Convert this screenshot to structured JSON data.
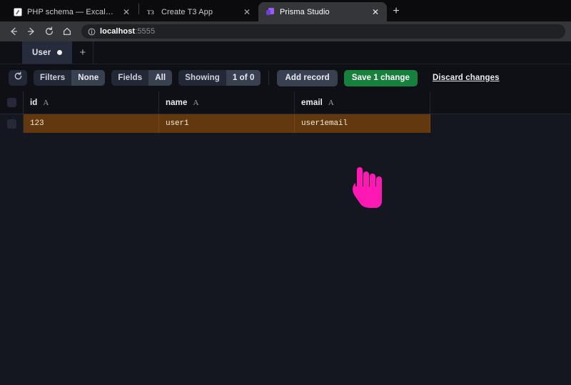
{
  "browser": {
    "tabs": [
      {
        "title": "PHP schema — Excalidraw Plus",
        "favicon": "excalidraw-icon",
        "active": false,
        "close_label": "✕"
      },
      {
        "title": "Create T3 App",
        "favicon": "t3-icon",
        "active": false,
        "close_label": "✕"
      },
      {
        "title": "Prisma Studio",
        "favicon": "prisma-icon",
        "active": true,
        "close_label": "✕"
      }
    ],
    "new_tab_label": "+",
    "nav": {
      "back_label": "←",
      "forward_label": "→",
      "reload_label": "↻",
      "home_label": "⌂",
      "info_label": "ⓘ",
      "url_host": "localhost",
      "url_port": ":5555"
    }
  },
  "app": {
    "model_tabs": [
      {
        "label": "User",
        "dirty": true
      }
    ],
    "add_tab_label": "+",
    "toolbar": {
      "refresh_icon": "refresh-icon",
      "filters_label": "Filters",
      "filters_value": "None",
      "fields_label": "Fields",
      "fields_value": "All",
      "showing_label": "Showing",
      "showing_value": "1 of 0",
      "add_record_label": "Add record",
      "save_label": "Save 1 change",
      "discard_label": "Discard changes",
      "save_color": "#16803c"
    },
    "grid": {
      "columns": [
        {
          "name": "id",
          "type": "A"
        },
        {
          "name": "name",
          "type": "A"
        },
        {
          "name": "email",
          "type": "A"
        }
      ],
      "rows": [
        {
          "dirty": true,
          "id": "123",
          "name": "user1",
          "email": "user1email"
        }
      ],
      "dirty_row_color": "#62380f"
    }
  },
  "cursor": {
    "type": "pointing-hand-cursor",
    "color": "#ff19b4"
  }
}
